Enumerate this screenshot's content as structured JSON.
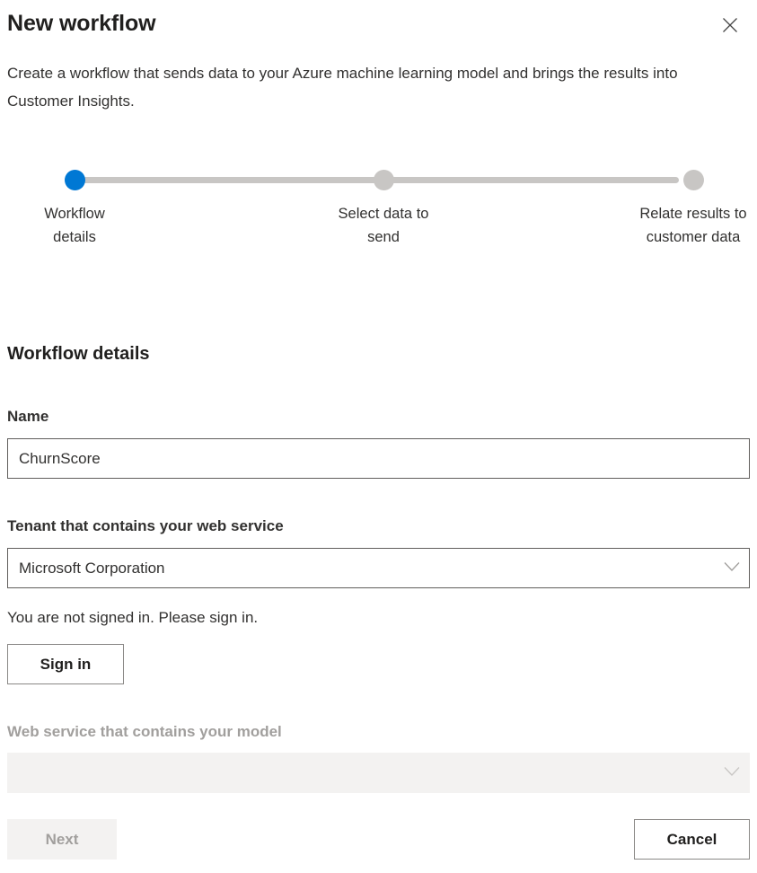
{
  "header": {
    "title": "New workflow",
    "close_icon": "close-icon",
    "description": "Create a workflow that sends data to your Azure machine learning model and brings the results into Customer Insights."
  },
  "stepper": {
    "active_index": 0,
    "active_color": "#0078d4",
    "inactive_color": "#c8c6c4",
    "steps": [
      {
        "label": "Workflow\ndetails"
      },
      {
        "label": "Select data to\nsend"
      },
      {
        "label": "Relate results to\ncustomer data"
      }
    ]
  },
  "form": {
    "section_title": "Workflow details",
    "name": {
      "label": "Name",
      "value": "ChurnScore",
      "placeholder": ""
    },
    "tenant": {
      "label": "Tenant that contains your web service",
      "value": "Microsoft Corporation",
      "chevron_icon": "chevron-down-icon",
      "disabled": false
    },
    "signin": {
      "message": "You are not signed in. Please sign in.",
      "button_label": "Sign in"
    },
    "web_service": {
      "label": "Web service that contains your model",
      "value": "",
      "chevron_icon": "chevron-down-icon",
      "disabled": true
    }
  },
  "footer": {
    "next_label": "Next",
    "next_disabled": true,
    "cancel_label": "Cancel",
    "cancel_disabled": false
  }
}
